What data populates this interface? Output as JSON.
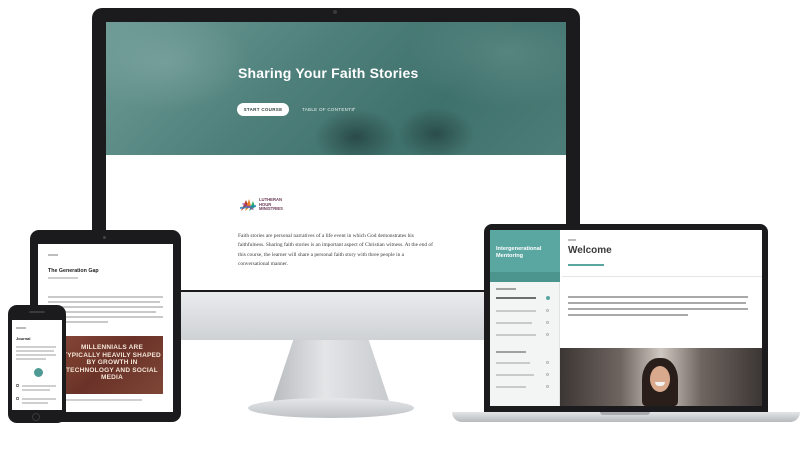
{
  "desktop": {
    "hero_title": "Sharing Your Faith Stories",
    "start_button": "START COURSE",
    "toc_link": "TABLE OF CONTENTS",
    "logo_text": "LUTHERAN HOUR MINISTRIES",
    "intro": "Faith stories are personal narratives of a life event in which God demonstrates his faithfulness. Sharing faith stories is an important aspect of Christian witness. At the end of this course, the learner will share a personal faith story with three people in a conversational manner."
  },
  "tablet": {
    "title": "The Generation Gap",
    "image_text": "MILLENNIALS ARE TYPICALLY HEAVILY SHAPED BY GROWTH IN TECHNOLOGY AND SOCIAL MEDIA"
  },
  "phone": {
    "title": "Journal"
  },
  "laptop": {
    "sidebar_title": "Intergenerational Mentoring",
    "lesson_title": "Welcome"
  },
  "colors": {
    "accent": "#5aa7a2",
    "hero": "#4f807b",
    "device_frame": "#1b1b1d"
  }
}
